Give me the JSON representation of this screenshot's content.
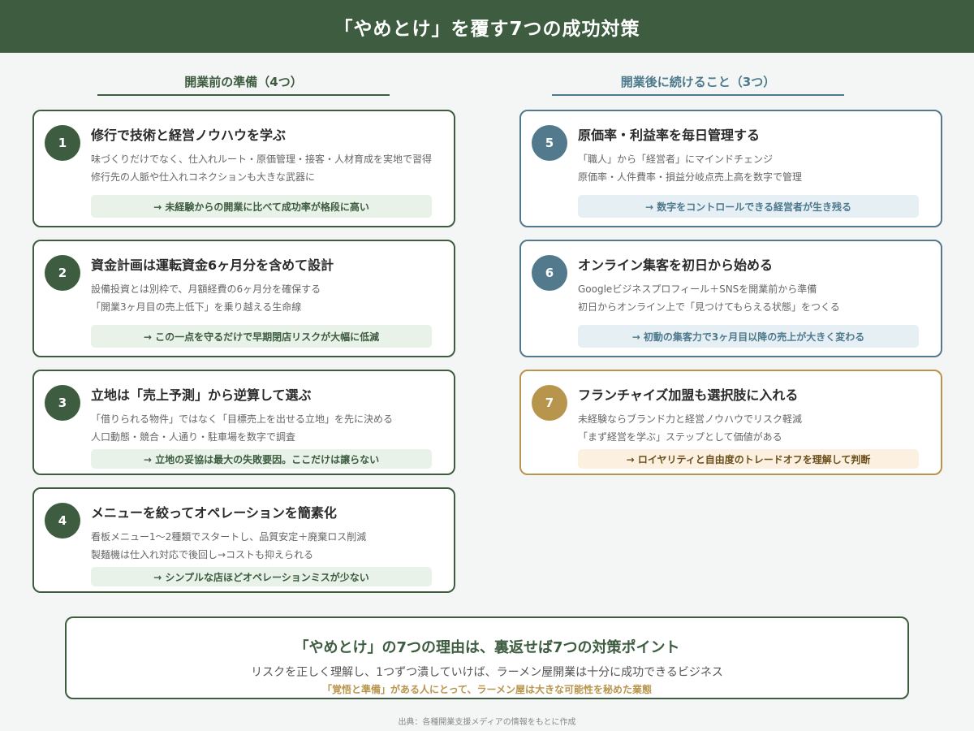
{
  "header": {
    "title": "「やめとけ」を覆す7つの成功対策"
  },
  "columns": {
    "left": "開業前の準備（4つ）",
    "right": "開業後に続けること（3つ）"
  },
  "cards": [
    {
      "num": "1",
      "title": "修行で技術と経営ノウハウを学ぶ",
      "line1": "味づくりだけでなく、仕入れルート・原価管理・接客・人材育成を実地で習得",
      "line2": "修行先の人脈や仕入れコネクションも大きな武器に",
      "result": "→ 未経験からの開業に比べて成功率が格段に高い"
    },
    {
      "num": "2",
      "title": "資金計画は運転資金6ヶ月分を含めて設計",
      "line1": "設備投資とは別枠で、月額経費の6ヶ月分を確保する",
      "line2": "「開業3ヶ月目の売上低下」を乗り越える生命線",
      "result": "→ この一点を守るだけで早期閉店リスクが大幅に低減"
    },
    {
      "num": "3",
      "title": "立地は「売上予測」から逆算して選ぶ",
      "line1": "「借りられる物件」ではなく「目標売上を出せる立地」を先に決める",
      "line2": "人口動態・競合・人通り・駐車場を数字で調査",
      "result": "→ 立地の妥協は最大の失敗要因。ここだけは譲らない"
    },
    {
      "num": "4",
      "title": "メニューを絞ってオペレーションを簡素化",
      "line1": "看板メニュー1〜2種類でスタートし、品質安定＋廃棄ロス削減",
      "line2": "製麺機は仕入れ対応で後回し→コストも抑えられる",
      "result": "→ シンプルな店ほどオペレーションミスが少ない"
    },
    {
      "num": "5",
      "title": "原価率・利益率を毎日管理する",
      "line1": "「職人」から「経営者」にマインドチェンジ",
      "line2": "原価率・人件費率・損益分岐点売上高を数字で管理",
      "result": "→ 数字をコントロールできる経営者が生き残る"
    },
    {
      "num": "6",
      "title": "オンライン集客を初日から始める",
      "line1": "Googleビジネスプロフィール＋SNSを開業前から準備",
      "line2": "初日からオンライン上で「見つけてもらえる状態」をつくる",
      "result": "→ 初動の集客力で3ヶ月目以降の売上が大きく変わる"
    },
    {
      "num": "7",
      "title": "フランチャイズ加盟も選択肢に入れる",
      "line1": "未経験ならブランド力と経営ノウハウでリスク軽減",
      "line2": "「まず経営を学ぶ」ステップとして価値がある",
      "result": "→ ロイヤリティと自由度のトレードオフを理解して判断"
    }
  ],
  "summary": {
    "title": "「やめとけ」の7つの理由は、裏返せば7つの対策ポイント",
    "body": "リスクを正しく理解し、1つずつ潰していけば、ラーメン屋開業は十分に成功できるビジネス",
    "emphasis": "「覚悟と準備」がある人にとって、ラーメン屋は大きな可能性を秘めた業態"
  },
  "source": "出典：各種開業支援メディアの情報をもとに作成"
}
